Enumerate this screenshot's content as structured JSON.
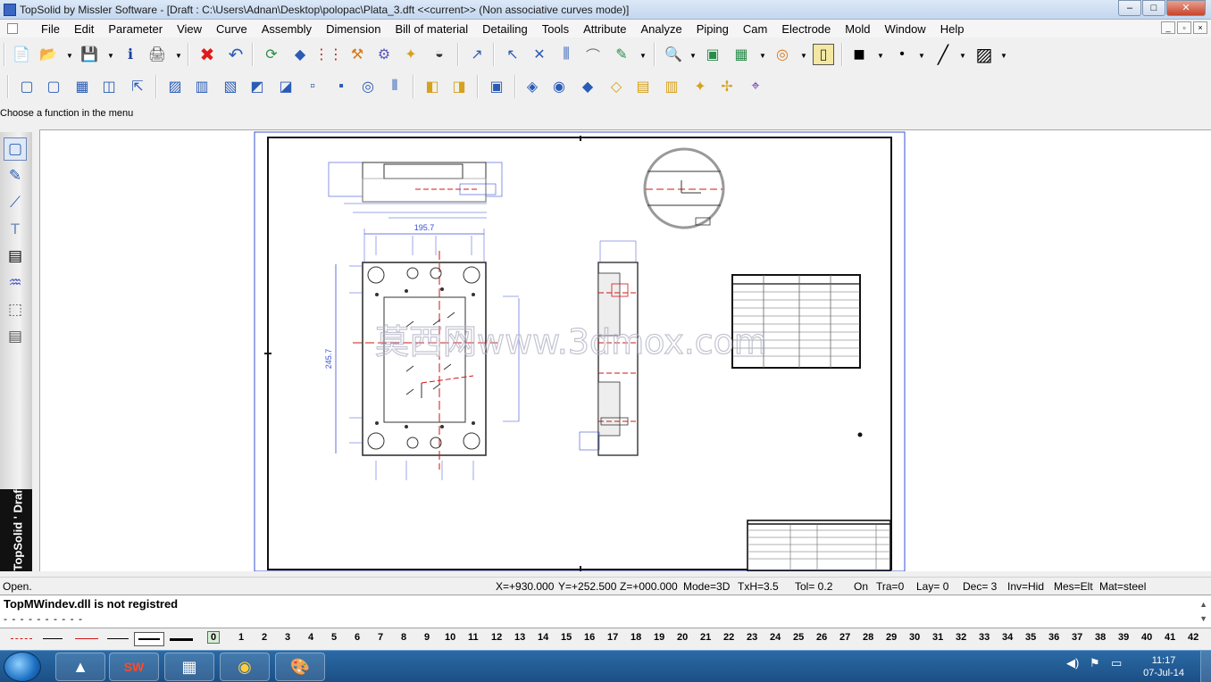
{
  "window": {
    "title": "TopSolid by Missler Software - [Draft : C:\\Users\\Adnan\\Desktop\\polopac\\Plata_3.dft  <<current>> (Non associative curves mode)]",
    "controls": {
      "minimize": "–",
      "maximize": "□",
      "close": "✕"
    }
  },
  "menu": {
    "items": [
      "File",
      "Edit",
      "Parameter",
      "View",
      "Curve",
      "Assembly",
      "Dimension",
      "Bill of material",
      "Detailing",
      "Tools",
      "Attribute",
      "Analyze",
      "Piping",
      "Cam",
      "Electrode",
      "Mold",
      "Window",
      "Help"
    ],
    "mdi_controls": [
      "_",
      "▫",
      "×"
    ]
  },
  "toolbar": {
    "icons": {
      "new": "📄",
      "open": "📂",
      "save": "💾",
      "info": "ℹ",
      "print": "🖨",
      "delete": "✖",
      "undo": "↶",
      "rotate": "⟳",
      "cube": "◆",
      "params": "⋮⋮",
      "hammer": "⚒",
      "gears": "⚙",
      "gear2": "✦",
      "arc": "◒",
      "cursor": "↗",
      "pick1": "↖",
      "cross": "✕",
      "slider": "⫼",
      "hook": "⌒",
      "cursor2": "✎",
      "zoom": "🔍",
      "fit": "▣",
      "image": "▦",
      "glasses": "◎",
      "cylinder": "▯",
      "color": "■",
      "dot": "•",
      "line": "╱",
      "hatch": "▨"
    },
    "row2": [
      "▢",
      "▢",
      "▦",
      "◫",
      "⇱",
      "▨",
      "▥",
      "▧",
      "◩",
      "◪",
      "▫",
      "▪",
      "◎",
      "⫴",
      "◧",
      "◨",
      "▣",
      "◈",
      "◉",
      "◆",
      "◇",
      "▤",
      "▥",
      "✦",
      "✢",
      "⌖"
    ]
  },
  "hint": "Choose a function in the menu",
  "sidebar": {
    "tools": [
      "▢",
      "✎",
      "⟋",
      "T",
      "▤",
      "♒",
      "⬚",
      "▤"
    ],
    "brand": "TopSolid ' Draft"
  },
  "drawing": {
    "dimensions": {
      "width": "195.7",
      "height": "245.7"
    },
    "watermark": "莫西网www.3dmox.com",
    "table_rows": 11
  },
  "status": {
    "left": "Open.",
    "x": "X=+930.000",
    "y": "Y=+252.500",
    "z": "Z=+000.000",
    "mode": "Mode=3D",
    "txh": "TxH=3.5",
    "tol": "Tol=  0.2",
    "on": "On",
    "tra": "Tra=0",
    "lay": "Lay=  0",
    "dec": "Dec= 3",
    "inv": "Inv=Hid",
    "mes": "Mes=Elt",
    "mat": "Mat=steel"
  },
  "console": {
    "line1": "TopMWindev.dll is not registred",
    "line2": "- - - - - - - - - -"
  },
  "layers": {
    "active": "0",
    "numbers": [
      "1",
      "2",
      "3",
      "4",
      "5",
      "6",
      "7",
      "8",
      "9",
      "10",
      "11",
      "12",
      "13",
      "14",
      "15",
      "16",
      "17",
      "18",
      "19",
      "20",
      "21",
      "22",
      "23",
      "24",
      "25",
      "26",
      "27",
      "28",
      "29",
      "30",
      "31",
      "32",
      "33",
      "34",
      "35",
      "36",
      "37",
      "38",
      "39",
      "40",
      "41",
      "42"
    ]
  },
  "taskbar": {
    "apps": [
      "▲",
      "SW",
      "▦",
      "◉",
      "🎨"
    ],
    "tray": [
      "◀)",
      "⚑",
      "▭"
    ],
    "time": "11:17",
    "date": "07-Jul-14"
  },
  "colors": {
    "accent": "#3a66c4",
    "dimension_blue": "#3b4fd6",
    "centerline_red": "#d01515"
  }
}
